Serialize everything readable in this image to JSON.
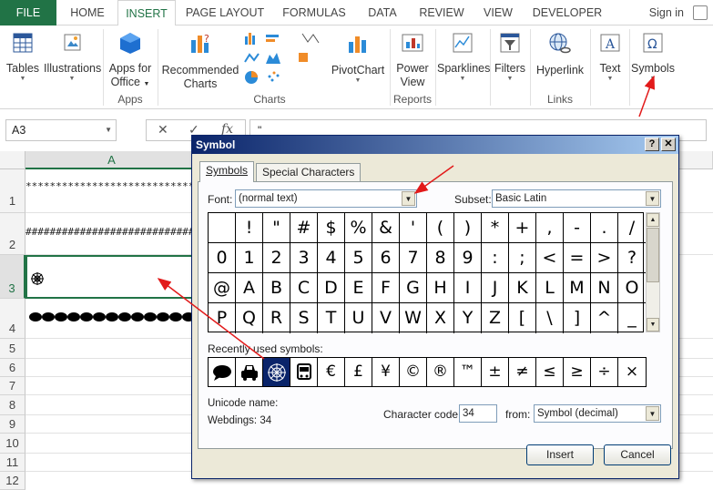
{
  "tabs": {
    "file": "FILE",
    "home": "HOME",
    "insert": "INSERT",
    "page_layout": "PAGE LAYOUT",
    "formulas": "FORMULAS",
    "data": "DATA",
    "review": "REVIEW",
    "view": "VIEW",
    "developer": "DEVELOPER",
    "sign_in": "Sign in"
  },
  "ribbon": {
    "tables": "Tables",
    "illustrations": "Illustrations",
    "apps_for_office_1": "Apps for",
    "apps_for_office_2": "Office",
    "recommended_charts_1": "Recommended",
    "recommended_charts_2": "Charts",
    "pivotchart": "PivotChart",
    "power_view_1": "Power",
    "power_view_2": "View",
    "sparklines": "Sparklines",
    "filters": "Filters",
    "hyperlink": "Hyperlink",
    "text": "Text",
    "symbols": "Symbols",
    "group_apps": "Apps",
    "group_charts": "Charts",
    "group_reports": "Reports",
    "group_links": "Links"
  },
  "formula_bar": {
    "name_box": "A3",
    "content": "\""
  },
  "sheet": {
    "column_a": "A",
    "rows": [
      "1",
      "2",
      "3",
      "4",
      "5",
      "6",
      "7",
      "8",
      "9",
      "10",
      "11",
      "12"
    ],
    "a1": "**********************************",
    "a2": "##################################",
    "a3_icon": "spider-web-symbol",
    "a4_icon": "speech-bubble-row"
  },
  "dialog": {
    "title": "Symbol",
    "help": "?",
    "close": "✕",
    "tab_symbols": "Symbols",
    "tab_special": "Special Characters",
    "font_label": "Font:",
    "font_value": "(normal text)",
    "subset_label": "Subset:",
    "subset_value": "Basic Latin",
    "symbol_rows": [
      [
        "",
        "!",
        "\"",
        "#",
        "$",
        "%",
        "&",
        "'",
        "(",
        ")",
        "*",
        "+",
        ",",
        "-",
        ".",
        "/"
      ],
      [
        "0",
        "1",
        "2",
        "3",
        "4",
        "5",
        "6",
        "7",
        "8",
        "9",
        ":",
        ";",
        "<",
        "=",
        ">",
        "?"
      ],
      [
        "@",
        "A",
        "B",
        "C",
        "D",
        "E",
        "F",
        "G",
        "H",
        "I",
        "J",
        "K",
        "L",
        "M",
        "N",
        "O"
      ],
      [
        "P",
        "Q",
        "R",
        "S",
        "T",
        "U",
        "V",
        "W",
        "X",
        "Y",
        "Z",
        "[",
        "\\",
        "]",
        "^",
        "_"
      ]
    ],
    "recent_label": "Recently used symbols:",
    "recent_symbols": [
      "€",
      "£",
      "¥",
      "©",
      "®",
      "™",
      "±",
      "≠",
      "≤",
      "≥",
      "÷",
      "×"
    ],
    "unicode_name_label": "Unicode name:",
    "unicode_name_value": "Webdings: 34",
    "char_code_label": "Character code:",
    "char_code_value": "34",
    "from_label": "from:",
    "from_value": "Symbol (decimal)",
    "insert_button": "Insert",
    "cancel_button": "Cancel"
  },
  "colors": {
    "excel_green": "#217346",
    "annotation_red": "#e21a1a",
    "dialog_title": "#0a246a"
  }
}
